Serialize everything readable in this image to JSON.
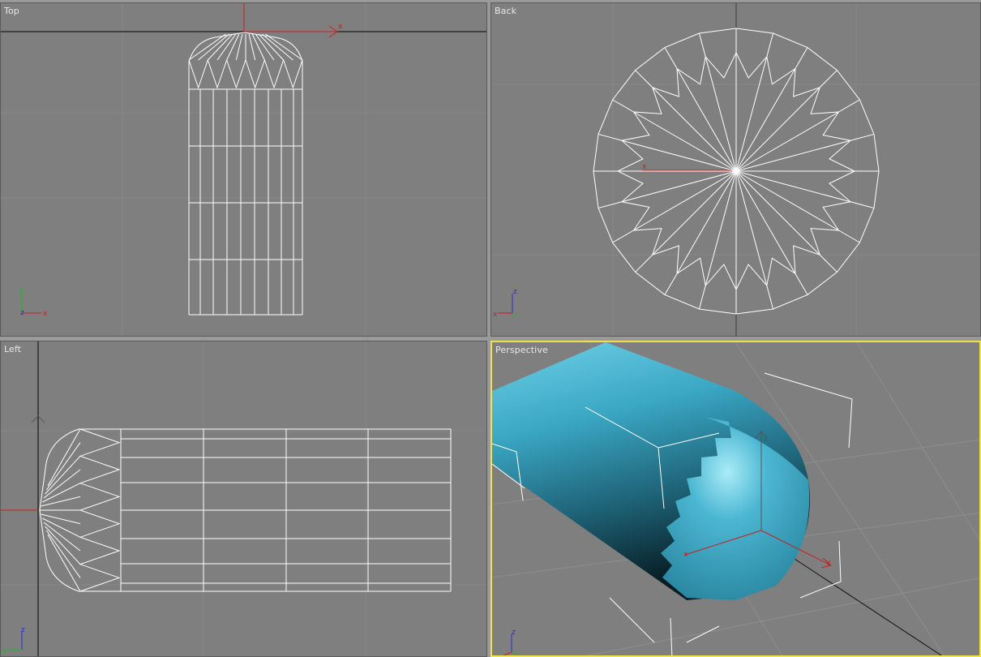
{
  "viewports": {
    "top": {
      "label": "Top",
      "axis_x": "x",
      "axis_y": "y",
      "axis_z": "z"
    },
    "back": {
      "label": "Back",
      "axis_x": "x",
      "axis_y": "y",
      "axis_z": "z"
    },
    "left": {
      "label": "Left",
      "axis_x": "y",
      "axis_y": "z",
      "axis_z": "x"
    },
    "perspective": {
      "label": "Perspective",
      "axis_x": "x",
      "axis_y": "y",
      "axis_z": "z"
    }
  },
  "colors": {
    "viewport_bg": "#7f7f7f",
    "wire": "#ffffff",
    "axis_red": "#c81e1e",
    "axis_green": "#1db81d",
    "axis_blue": "#2a2ad0",
    "active_border": "#f2e24a",
    "object_fill": "#3aa7c4"
  }
}
